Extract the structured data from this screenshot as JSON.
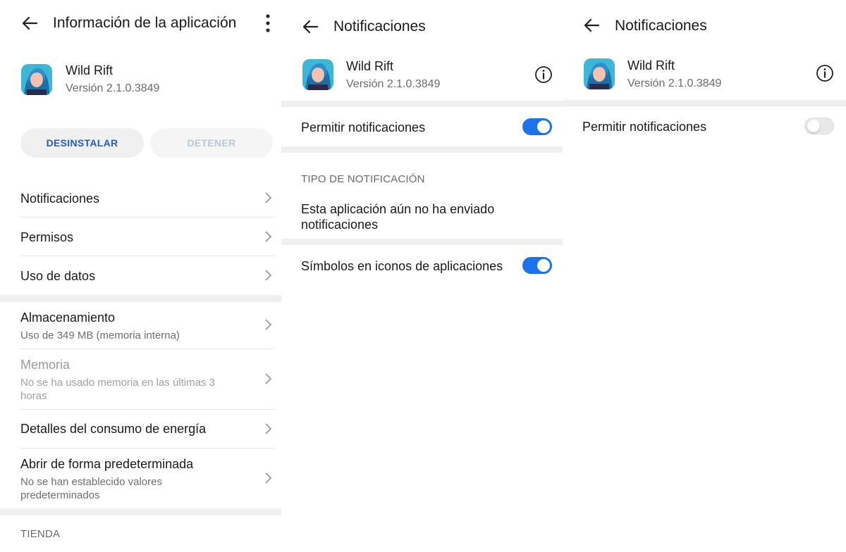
{
  "colors": {
    "accent": "#1a73e8",
    "uninstall_text": "#1f5fbf",
    "separator": "#efefef"
  },
  "app": {
    "name": "Wild Rift",
    "version": "Versión 2.1.0.3849"
  },
  "screen1": {
    "title": "Información de la aplicación",
    "buttons": {
      "uninstall": "DESINSTALAR",
      "stop": "DETENER"
    },
    "rows": [
      {
        "title": "Notificaciones"
      },
      {
        "title": "Permisos"
      },
      {
        "title": "Uso de datos"
      },
      {
        "title": "Almacenamiento",
        "subtitle": "Uso de 349 MB (memoria interna)"
      },
      {
        "title": "Memoria",
        "subtitle": "No se ha usado memoria en las últimas 3 horas",
        "disabled": true
      },
      {
        "title": "Detalles del consumo de energía"
      },
      {
        "title": "Abrir de forma predeterminada",
        "subtitle": "No se han establecido valores predeterminados"
      }
    ],
    "section_store": "TIENDA"
  },
  "screen2": {
    "title": "Notificaciones",
    "allow_label": "Permitir notificaciones",
    "allow_on": true,
    "section_type": "TIPO DE NOTIFICACIÓN",
    "no_notif_text": "Esta aplicación aún no ha enviado notificaciones",
    "badges_label": "Símbolos en iconos de aplicaciones",
    "badges_on": true
  },
  "screen3": {
    "title": "Notificaciones",
    "allow_label": "Permitir notificaciones",
    "allow_on": false
  }
}
